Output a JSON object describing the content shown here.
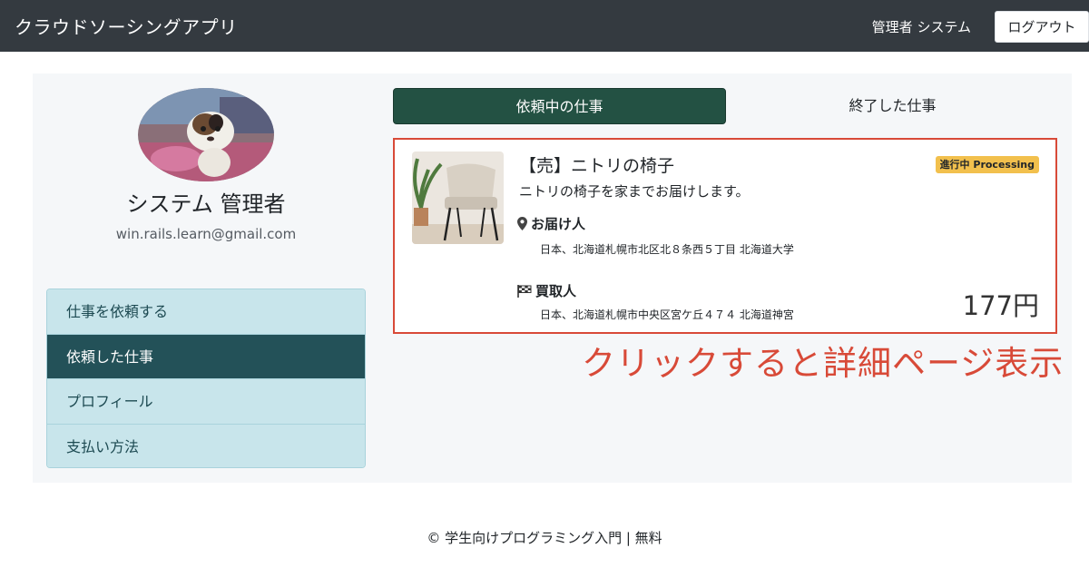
{
  "navbar": {
    "brand": "クラウドソーシングアプリ",
    "user": "管理者 システム",
    "logout_label": "ログアウト"
  },
  "profile": {
    "name": "システム 管理者",
    "email": "win.rails.learn@gmail.com"
  },
  "side_menu": {
    "items": [
      {
        "label": "仕事を依頼する"
      },
      {
        "label": "依頼した仕事"
      },
      {
        "label": "プロフィール"
      },
      {
        "label": "支払い方法"
      }
    ],
    "active_index": 1
  },
  "tabs": [
    {
      "label": "依頼中の仕事"
    },
    {
      "label": "終了した仕事"
    }
  ],
  "job": {
    "title": "【売】ニトリの椅子",
    "description": "ニトリの椅子を家までお届けします。",
    "status": "進行中 Processing",
    "delivery_label": "お届け人",
    "delivery_address": "日本、北海道札幌市北区北８条西５丁目 北海道大学",
    "buyer_label": "買取人",
    "buyer_address": "日本、北海道札幌市中央区宮ケ丘４７４ 北海道神宮",
    "price": "177円"
  },
  "annotation": "クリックすると詳細ページ表示",
  "footer": "© 学生向けプログラミング入門 | 無料",
  "colors": {
    "navbar": "#343a40",
    "tab_active": "#235143",
    "side_active": "#235158",
    "side_item": "#c8e5eb",
    "badge": "#f2c04d",
    "highlight": "#d84a38"
  },
  "icons": {
    "delivery": "map-pin-icon",
    "buyer": "checkered-flag-icon"
  }
}
